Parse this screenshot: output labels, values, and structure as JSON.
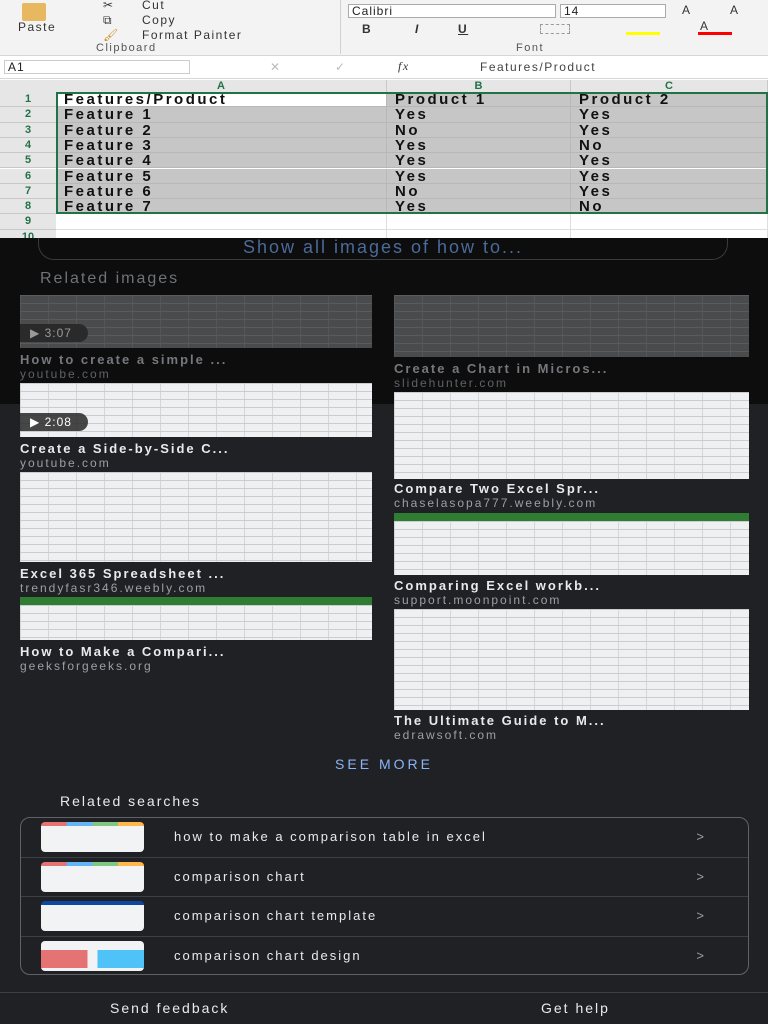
{
  "excel": {
    "clipboard": {
      "paste": "Paste",
      "cut": "Cut",
      "copy": "Copy",
      "format_painter": "Format Painter",
      "group": "Clipboard"
    },
    "font": {
      "name": "Calibri",
      "size": "14",
      "bold": "B",
      "italic": "I",
      "underline": "U",
      "group": "Font",
      "grow": "A",
      "shrink": "A",
      "fill_color": "#ffff00",
      "font_color": "#ff0000"
    },
    "name_box": "A1",
    "fx": "fx",
    "formula": "Features/Product",
    "columns": [
      "A",
      "B",
      "C"
    ],
    "row_numbers": [
      "1",
      "2",
      "3",
      "4",
      "5",
      "6",
      "7",
      "8",
      "9",
      "10"
    ],
    "rows": [
      [
        "Features/Product",
        "Product 1",
        "Product 2"
      ],
      [
        "Feature 1",
        "Yes",
        "Yes"
      ],
      [
        "Feature 2",
        "No",
        "Yes"
      ],
      [
        "Feature 3",
        "Yes",
        "No"
      ],
      [
        "Feature 4",
        "Yes",
        "Yes"
      ],
      [
        "Feature 5",
        "Yes",
        "Yes"
      ],
      [
        "Feature 6",
        "No",
        "Yes"
      ],
      [
        "Feature 7",
        "Yes",
        "No"
      ]
    ]
  },
  "show_all": "Show all images of how to...",
  "related_images_heading": "Related images",
  "related_images": [
    {
      "title": "How to create a simple ...",
      "source": "youtube.com",
      "duration": "3:07"
    },
    {
      "title": "Create a Chart in Micros...",
      "source": "slidehunter.com"
    },
    {
      "title": "Create a Side-by-Side C...",
      "source": "youtube.com",
      "duration": "2:08"
    },
    {
      "title": "Compare Two Excel Spr...",
      "source": "chaselasopa777.weebly.com"
    },
    {
      "title": "Excel 365 Spreadsheet ...",
      "source": "trendyfasr346.weebly.com"
    },
    {
      "title": "Comparing Excel workb...",
      "source": "support.moonpoint.com"
    },
    {
      "title": "How to Make a Compari...",
      "source": "geeksforgeeks.org"
    },
    {
      "title": "The Ultimate Guide to M...",
      "source": "edrawsoft.com"
    }
  ],
  "see_more": "SEE MORE",
  "related_searches_heading": "Related searches",
  "related_searches": [
    "how to make a comparison table in excel",
    "comparison chart",
    "comparison chart template",
    "comparison chart design"
  ],
  "chevron": ">",
  "footer": {
    "feedback": "Send feedback",
    "help": "Get help"
  }
}
